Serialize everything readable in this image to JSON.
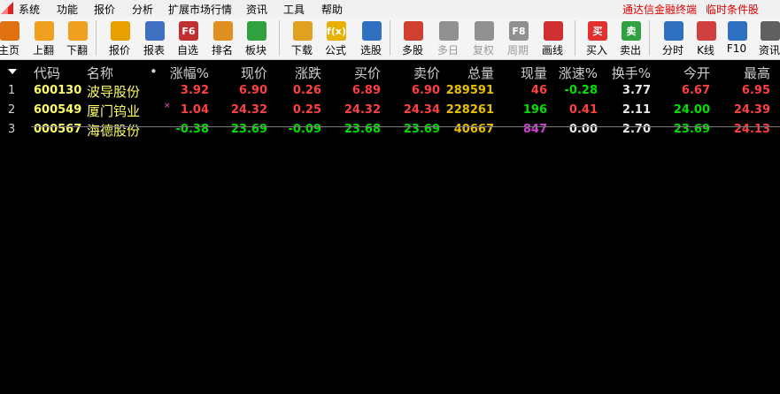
{
  "menu": {
    "items": [
      "系统",
      "功能",
      "报价",
      "分析",
      "扩展市场行情",
      "资讯",
      "工具",
      "帮助"
    ],
    "promo": [
      "通达信金融终端",
      "临时条件股"
    ]
  },
  "toolbar": {
    "buttons": [
      {
        "label": "主页",
        "icon": "home-icon",
        "color": "#e07010"
      },
      {
        "label": "上翻",
        "icon": "arrow-up-icon",
        "color": "#f0a020"
      },
      {
        "label": "下翻",
        "icon": "arrow-down-icon",
        "color": "#f0a020"
      },
      {
        "label": "报价",
        "icon": "yen-icon",
        "color": "#e8a000"
      },
      {
        "label": "报表",
        "icon": "report-icon",
        "color": "#4070c0"
      },
      {
        "label": "自选",
        "icon": "f6-icon",
        "glyph": "F6",
        "color": "#c03030"
      },
      {
        "label": "排名",
        "icon": "ranking-icon",
        "color": "#e09020"
      },
      {
        "label": "板块",
        "icon": "blocks-icon",
        "color": "#30a040"
      },
      {
        "label": "下载",
        "icon": "download-icon",
        "color": "#e0a020"
      },
      {
        "label": "公式",
        "icon": "formula-icon",
        "glyph": "f(x)",
        "color": "#e8b000"
      },
      {
        "label": "选股",
        "icon": "stock-pick-icon",
        "color": "#3070c0"
      },
      {
        "label": "多股",
        "icon": "multi-stock-icon",
        "color": "#d04030"
      },
      {
        "label": "多日",
        "icon": "clock-icon",
        "color": "#909090",
        "disabled": true
      },
      {
        "label": "复权",
        "icon": "adjust-icon",
        "color": "#909090",
        "disabled": true
      },
      {
        "label": "周期",
        "icon": "f8-icon",
        "glyph": "F8",
        "color": "#909090",
        "disabled": true
      },
      {
        "label": "画线",
        "icon": "draw-line-icon",
        "color": "#d03030"
      },
      {
        "label": "买入",
        "icon": "buy-icon",
        "glyph": "买",
        "color": "#e03030"
      },
      {
        "label": "卖出",
        "icon": "sell-icon",
        "glyph": "卖",
        "color": "#30a040"
      },
      {
        "label": "分时",
        "icon": "intraday-chart-icon",
        "color": "#3070c0"
      },
      {
        "label": "K线",
        "icon": "kline-icon",
        "color": "#d04040"
      },
      {
        "label": "F10",
        "icon": "f10-icon",
        "color": "#3070c0"
      },
      {
        "label": "资讯",
        "icon": "news-icon",
        "color": "#606060"
      }
    ]
  },
  "grid": {
    "headers": [
      "代码",
      "名称",
      "•",
      "涨幅%",
      "现价",
      "涨跌",
      "买价",
      "卖价",
      "总量",
      "现量",
      "涨速%",
      "换手%",
      "今开",
      "最高"
    ],
    "rows": [
      {
        "index": "1",
        "code": "600130",
        "name": "波导股份",
        "mark": "",
        "pct": "3.92",
        "price": "6.90",
        "chg": "0.26",
        "bid": "6.89",
        "ask": "6.90",
        "vol": "289591",
        "cur": "46",
        "speed": "-0.28",
        "turn": "3.77",
        "open": "6.67",
        "high": "6.95"
      },
      {
        "index": "2",
        "code": "600549",
        "name": "厦门钨业",
        "mark": "×",
        "pct": "1.04",
        "price": "24.32",
        "chg": "0.25",
        "bid": "24.32",
        "ask": "24.34",
        "vol": "228261",
        "cur": "196",
        "speed": "0.41",
        "turn": "2.11",
        "open": "24.00",
        "high": "24.39"
      },
      {
        "index": "3",
        "code": "000567",
        "name": "海德股份",
        "mark": "",
        "pct": "-0.38",
        "price": "23.69",
        "chg": "-0.09",
        "bid": "23.68",
        "ask": "23.69",
        "vol": "40667",
        "cur": "847",
        "speed": "0.00",
        "turn": "2.70",
        "open": "23.69",
        "high": "24.13"
      }
    ]
  },
  "colors": {
    "up": "#ff4040",
    "down": "#00e000",
    "neutral": "#e8e8e8",
    "volume": "#e8c000",
    "code": "#ffff66",
    "bigVolume": "#d040d0"
  }
}
